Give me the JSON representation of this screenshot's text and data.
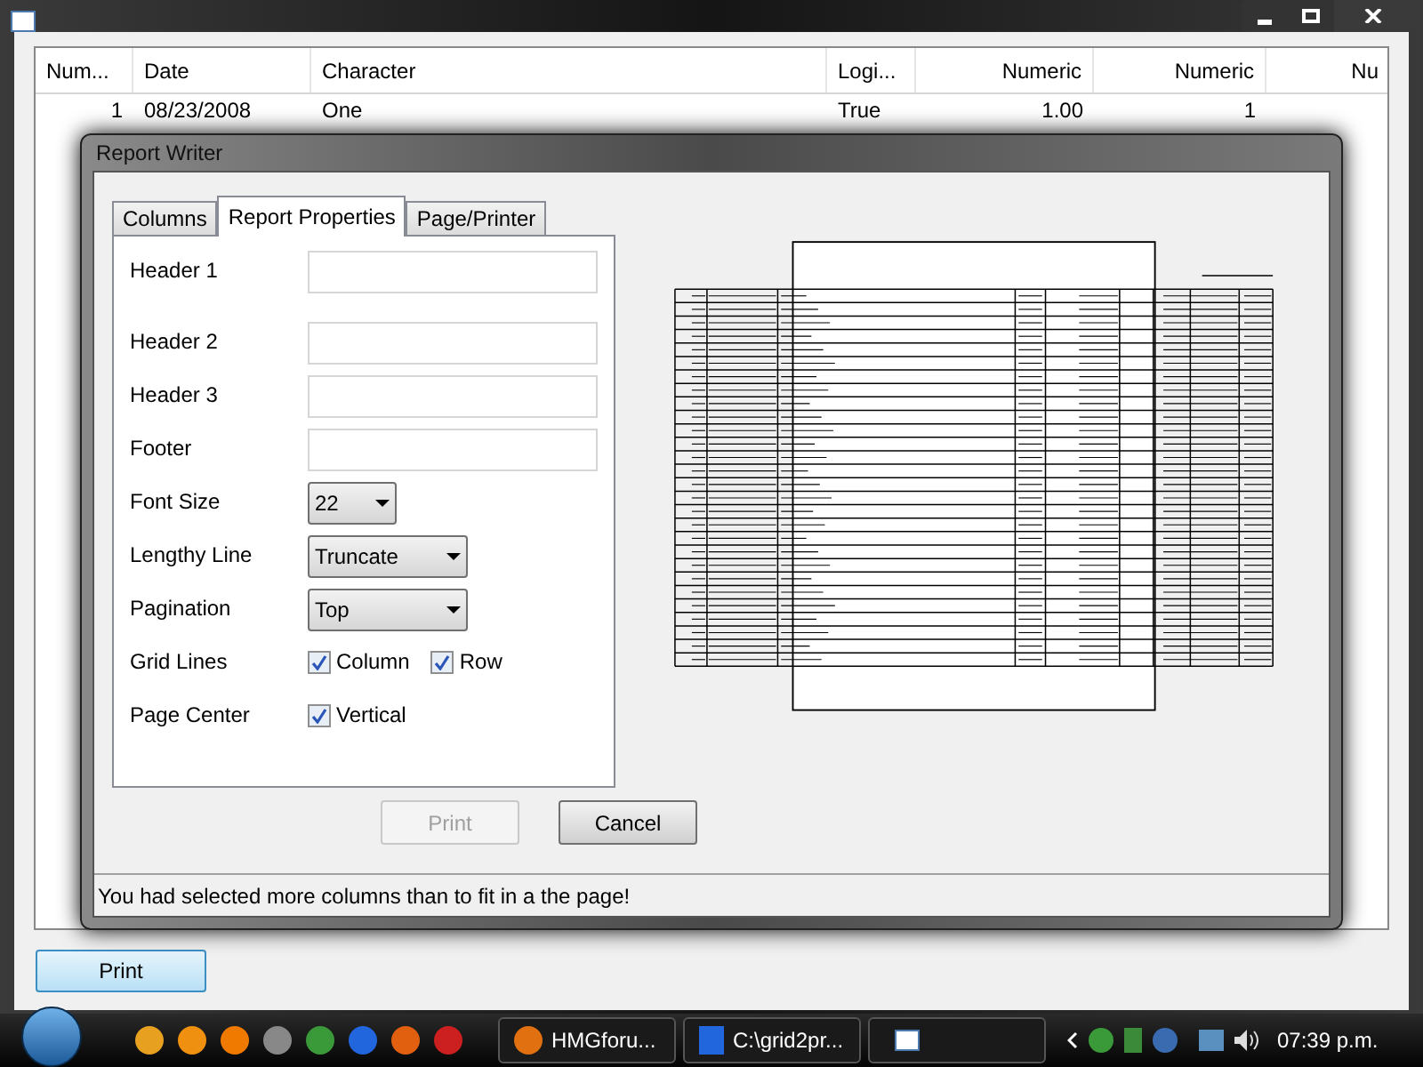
{
  "grid": {
    "columns": [
      {
        "label": "Num..."
      },
      {
        "label": "Date"
      },
      {
        "label": "Character"
      },
      {
        "label": "Logi..."
      },
      {
        "label": "Numeric"
      },
      {
        "label": "Numeric"
      },
      {
        "label": "Nu"
      }
    ],
    "rows": [
      [
        "1",
        "08/23/2008",
        "One",
        "True",
        "1.00",
        "1",
        ""
      ]
    ]
  },
  "main_button": "Print",
  "dialog": {
    "title": "Report Writer",
    "tabs": [
      {
        "label": "Columns",
        "selected": false
      },
      {
        "label": "Report Properties",
        "selected": true
      },
      {
        "label": "Page/Printer",
        "selected": false
      }
    ],
    "fields": [
      {
        "kind": "text",
        "label": "Header 1"
      },
      {
        "kind": "text",
        "label": "Header 2"
      },
      {
        "kind": "text",
        "label": "Header 3"
      },
      {
        "kind": "text",
        "label": "Footer"
      },
      {
        "kind": "select",
        "label": "Font Size",
        "value": "22"
      },
      {
        "kind": "select",
        "label": "Lengthy Line",
        "value": "Truncate"
      },
      {
        "kind": "select",
        "label": "Pagination",
        "value": "Top"
      },
      {
        "kind": "checks",
        "label": "Grid Lines",
        "options": [
          {
            "label": "Column",
            "checked": true
          },
          {
            "label": "Row",
            "checked": true
          }
        ]
      },
      {
        "kind": "checks",
        "label": "Page Center",
        "options": [
          {
            "label": "Vertical",
            "checked": true
          }
        ]
      }
    ],
    "buttons": [
      {
        "label": "Print",
        "disabled": true
      },
      {
        "label": "Cancel",
        "disabled": false
      }
    ],
    "status": "You had selected more columns than to fit in a the page!"
  },
  "taskbar": {
    "tasks": [
      {
        "label": "HMGforu..."
      },
      {
        "label": "C:\\grid2pr..."
      }
    ],
    "clock": "07:39 p.m."
  }
}
